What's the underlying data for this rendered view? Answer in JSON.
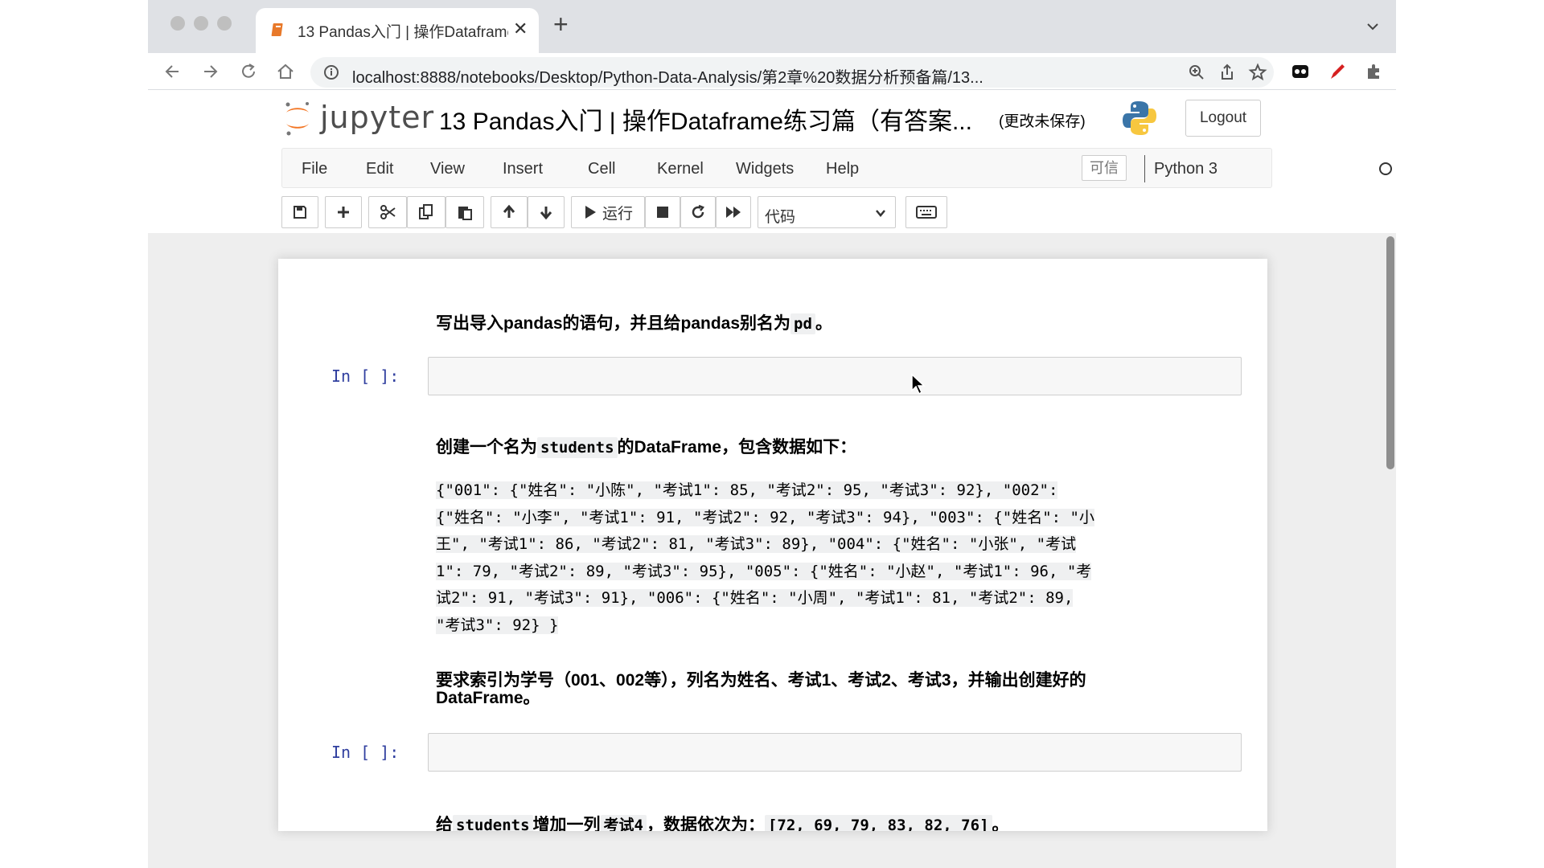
{
  "browser": {
    "tab_title": "13 Pandas入门 | 操作Dataframe",
    "url": "localhost:8888/notebooks/Desktop/Python-Data-Analysis/第2章%20数据分析预备篇/13..."
  },
  "jupyter": {
    "logo_text": "jupyter",
    "notebook_title": "13 Pandas入门 | 操作Dataframe练习篇（有答案...",
    "save_status": "(更改未保存)",
    "logout_label": "Logout"
  },
  "menu": {
    "items": [
      "File",
      "Edit",
      "View",
      "Insert",
      "Cell",
      "Kernel",
      "Widgets",
      "Help"
    ],
    "trusted_label": "可信",
    "kernel_name": "Python 3"
  },
  "toolbar": {
    "run_label": "运行",
    "cell_type": "代码"
  },
  "cells": {
    "md1_pre": "写出导入pandas的语句，并且给pandas别名为",
    "md1_code": "pd",
    "md1_post": "。",
    "prompt1": "In [ ]:",
    "md2_pre": "创建一个名为",
    "md2_code": "students",
    "md2_post": "的DataFrame，包含数据如下：",
    "data_lines": [
      "{\"001\": {\"姓名\": \"小陈\", \"考试1\": 85, \"考试2\": 95, \"考试3\": 92},  \"002\":",
      "{\"姓名\": \"小李\", \"考试1\": 91, \"考试2\": 92, \"考试3\": 94},  \"003\": {\"姓名\": \"小",
      "王\", \"考试1\": 86, \"考试2\": 81, \"考试3\": 89},  \"004\": {\"姓名\": \"小张\", \"考试",
      "1\": 79, \"考试2\": 89, \"考试3\": 95},  \"005\": {\"姓名\": \"小赵\", \"考试1\": 96, \"考",
      "试2\": 91, \"考试3\": 91},  \"006\": {\"姓名\": \"小周\", \"考试1\": 81, \"考试2\": 89,",
      "\"考试3\": 92}  }"
    ],
    "md3_line1": "要求索引为学号（001、002等），列名为姓名、考试1、考试2、考试3，并输出创建好的",
    "md3_line2": "DataFrame。",
    "prompt2": "In [ ]:",
    "md4_pre": "给",
    "md4_code": "students",
    "md4_mid": "增加一列",
    "md4_code2": "考试4",
    "md4_mid2": "，数据依次为：",
    "md4_code3": "[72, 69, 79, 83, 82, 76]",
    "md4_post": "。"
  }
}
